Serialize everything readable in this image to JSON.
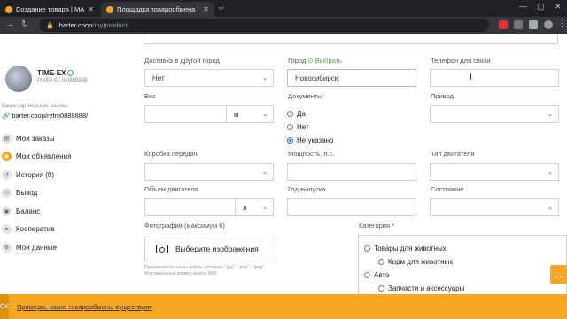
{
  "browser": {
    "tabs": [
      {
        "title": "Создание товара | МАО Бартер",
        "active": false
      },
      {
        "title": "Площадка товарообмена | МАО",
        "active": true
      }
    ],
    "new_tab": "+",
    "url_host": "barter.coop",
    "url_path": "/my/product/",
    "window_controls": {
      "minimize": "—",
      "maximize": "▢",
      "close": "✕"
    },
    "nav": {
      "back": "←",
      "forward": "→",
      "reload": "↻"
    }
  },
  "profile": {
    "name": "TIME-EX",
    "profile_id": "Profile ID: m0888888",
    "ref_label": "Ваша партнерская ссылка:",
    "ref_link": "barter.coop/refm0888888/"
  },
  "menu": [
    {
      "label": "Мои заказы",
      "icon": "orders-icon",
      "active": false
    },
    {
      "label": "Мои объявления",
      "icon": "ads-icon",
      "active": true
    },
    {
      "label": "История (0)",
      "icon": "history-icon",
      "active": false
    },
    {
      "label": "Вывод",
      "icon": "withdraw-icon",
      "active": false
    },
    {
      "label": "Баланс",
      "icon": "balance-icon",
      "active": false
    },
    {
      "label": "Кооператив",
      "icon": "coop-icon",
      "active": false
    },
    {
      "label": "Мои данные",
      "icon": "settings-icon",
      "active": false
    }
  ],
  "form": {
    "delivery_label": "Доставка в другой город",
    "delivery_value": "Нет",
    "city_label": "Город",
    "city_pick": "⊙ Выбрать",
    "city_value": "Новосибирск",
    "phone_label": "Телефон для связи",
    "phone_value": "",
    "weight_label": "Вес",
    "weight_unit": "кг",
    "docs_label": "Документы",
    "docs_options": [
      {
        "label": "Да",
        "checked": false
      },
      {
        "label": "Нет",
        "checked": false
      },
      {
        "label": "Не указано",
        "checked": true
      }
    ],
    "drive_label": "Привод",
    "gearbox_label": "Коробка передач",
    "power_label": "Мощность, л.с.",
    "engine_label": "Тип двигателя",
    "volume_label": "Объем двигателя",
    "volume_unit": "л",
    "year_label": "Год выпуска",
    "state_label": "Состояние",
    "photos_label": "Фотографии (максимум 6)",
    "upload_button": "Выберите изображения",
    "photo_hint_1": "Принимаются только файлы формата \".jpg\", \".png\", \".jpeg\"",
    "photo_hint_2": "Максимальный размер файла 5Мб",
    "category_label": "Категория *",
    "categories": [
      {
        "label": "Товары для животных",
        "level": 0
      },
      {
        "label": "Корм для животных",
        "level": 1
      },
      {
        "label": "Авто",
        "level": 0
      },
      {
        "label": "Запчасти и аксессуары",
        "level": 1
      }
    ]
  },
  "banner": {
    "ok": "OK",
    "text": "Примеры, какие товарообмены существуют"
  },
  "scroll_up": "︿",
  "colors": {
    "accent": "#f5a623",
    "green": "#4caf50",
    "chrome_dark": "#202124",
    "chrome_mid": "#35363a"
  }
}
